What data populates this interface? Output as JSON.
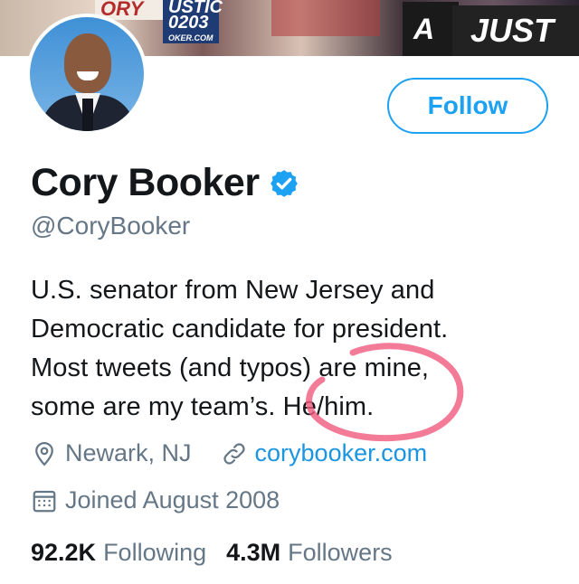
{
  "banner": {
    "sign_partial_1": "ORY",
    "sign_code": "USTIC 0203",
    "sign_url": "OKER.COM",
    "sign_partial_2": "A",
    "sign_partial_3": "JUST"
  },
  "profile": {
    "name": "Cory Booker",
    "handle": "@CoryBooker",
    "verified": true,
    "bio_lines": [
      "U.S. senator from New Jersey and",
      "Democratic candidate for president.",
      "Most tweets (and typos) are mine,",
      "some are my team’s. He/him."
    ],
    "location": "Newark, NJ",
    "website": "corybooker.com",
    "joined": "Joined August 2008"
  },
  "actions": {
    "follow_label": "Follow"
  },
  "stats": {
    "following_count": "92.2K",
    "following_label": "Following",
    "followers_count": "4.3M",
    "followers_label": "Followers"
  },
  "icons": {
    "location": "location-pin-icon",
    "link": "link-icon",
    "calendar": "calendar-icon",
    "verified": "verified-badge-icon"
  },
  "colors": {
    "accent": "#1da1f2",
    "link": "#1b95e0",
    "secondary_text": "#657786",
    "annotation": "#f05a7e"
  }
}
